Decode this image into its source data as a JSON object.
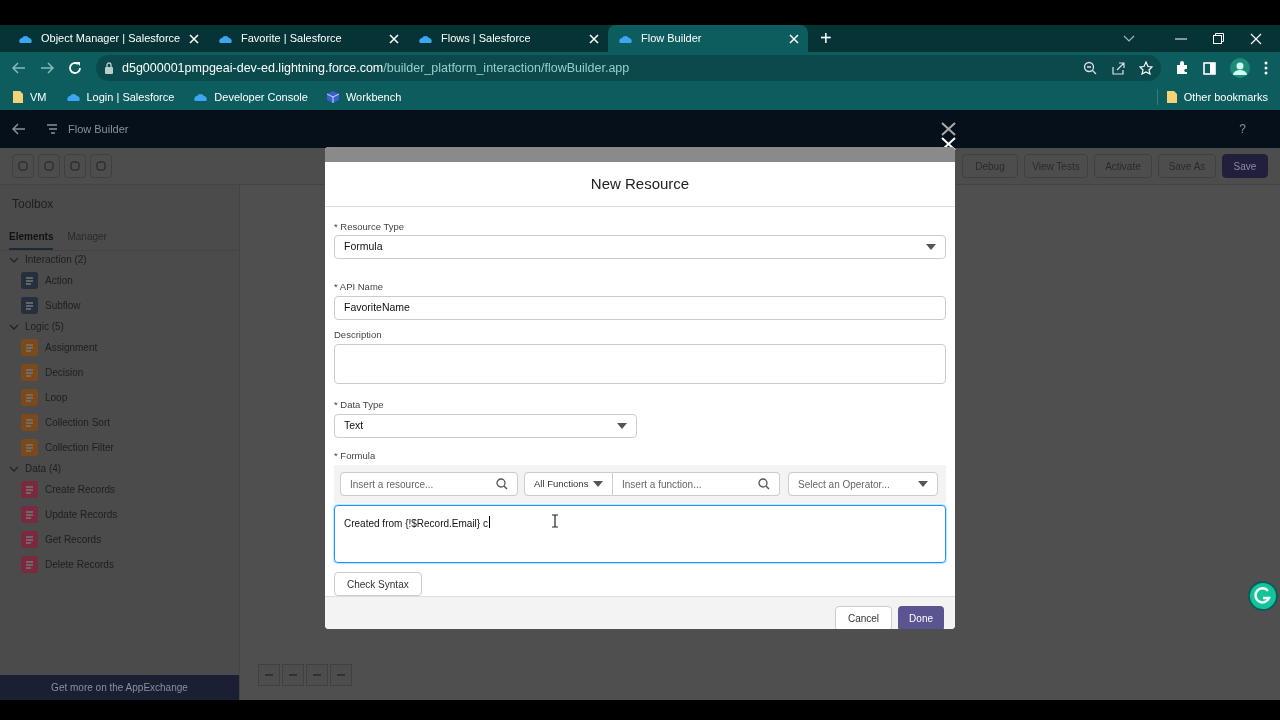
{
  "browser": {
    "tabs": [
      {
        "title": "Object Manager | Salesforce",
        "selected": false
      },
      {
        "title": "Favorite | Salesforce",
        "selected": false
      },
      {
        "title": "Flows | Salesforce",
        "selected": false
      },
      {
        "title": "Flow Builder",
        "selected": true
      }
    ],
    "new_tab": "+",
    "url_host": "d5g000001pmpgeai-dev-ed.lightning.force.com",
    "url_path": "/builder_platform_interaction/flowBuilder.app",
    "bookmarks": [
      {
        "label": "VM",
        "kind": "folder"
      },
      {
        "label": "Login | Salesforce",
        "kind": "cloud"
      },
      {
        "label": "Developer Console",
        "kind": "cloud"
      },
      {
        "label": "Workbench",
        "kind": "cube"
      }
    ],
    "other_bookmarks": "Other bookmarks"
  },
  "app": {
    "title": "Flow Builder",
    "help": "?",
    "toolbar_buttons": [
      {
        "label": "Debug",
        "primary": false
      },
      {
        "label": "View Tests",
        "primary": false
      },
      {
        "label": "Activate",
        "primary": false
      },
      {
        "label": "Save As",
        "primary": false
      },
      {
        "label": "Save",
        "primary": true
      }
    ],
    "toolbox": {
      "title": "Toolbox",
      "tabs": [
        {
          "label": "Elements",
          "selected": true
        },
        {
          "label": "Manager",
          "selected": false
        }
      ],
      "sections": [
        {
          "label": "Interaction (2)",
          "expanded": true,
          "children": [
            {
              "label": "Action",
              "color": "#26303d"
            },
            {
              "label": "Subflow",
              "color": "#26303d"
            }
          ]
        },
        {
          "label": "Logic (5)",
          "expanded": true,
          "children": [
            {
              "label": "Assignment",
              "color": "#7a4a1c"
            },
            {
              "label": "Decision",
              "color": "#7a4a1c"
            },
            {
              "label": "Loop",
              "color": "#7a4a1c"
            },
            {
              "label": "Collection Sort",
              "color": "#7a4a1c"
            },
            {
              "label": "Collection Filter",
              "color": "#7a4a1c"
            }
          ]
        },
        {
          "label": "Data (4)",
          "expanded": true,
          "children": [
            {
              "label": "Create Records",
              "color": "#7a2a3e"
            },
            {
              "label": "Update Records",
              "color": "#7a2a3e"
            },
            {
              "label": "Get Records",
              "color": "#7a2a3e"
            },
            {
              "label": "Delete Records",
              "color": "#7a2a3e"
            }
          ]
        }
      ],
      "footer_link": "Get more on the AppExchange"
    }
  },
  "modal": {
    "title": "New Resource",
    "resource_type": {
      "label": "Resource Type",
      "required_mark": "*",
      "value": "Formula"
    },
    "api_name": {
      "label": "API Name",
      "required_mark": "*",
      "value": "FavoriteName"
    },
    "description": {
      "label": "Description"
    },
    "data_type": {
      "label": "Data Type",
      "required_mark": "*",
      "value": "Text"
    },
    "formula": {
      "label": "Formula",
      "required_mark": "*",
      "resource_placeholder": "Insert a resource...",
      "functions_filter": "All Functions",
      "function_placeholder": "Insert a function...",
      "operator_placeholder": "Select an Operator...",
      "value": "Created from {!$Record.Email} c",
      "focused": true
    },
    "check_syntax": "Check Syntax",
    "cancel": "Cancel",
    "done": "Done"
  }
}
